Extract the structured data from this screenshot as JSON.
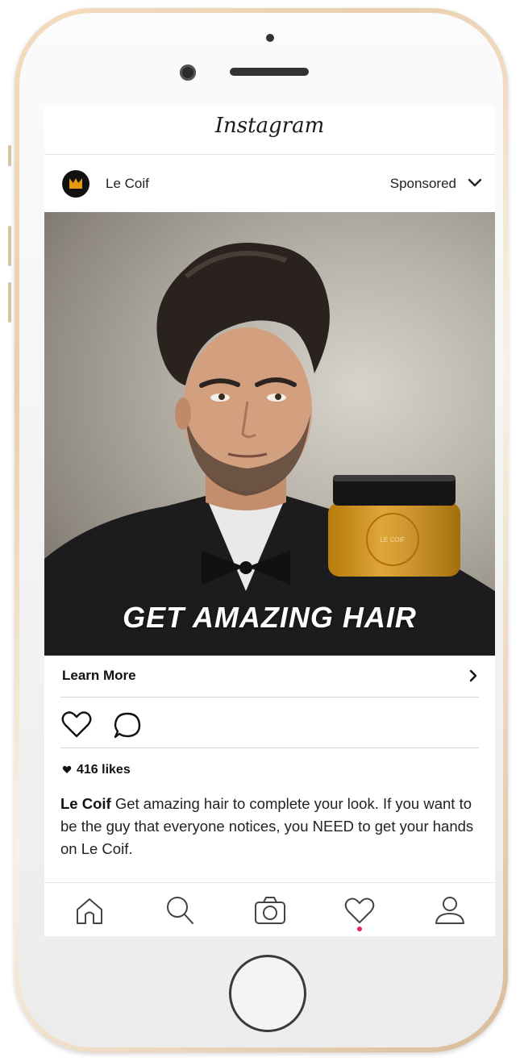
{
  "header": {
    "app_title": "Instagram"
  },
  "post": {
    "username": "Le Coif",
    "sponsored_label": "Sponsored",
    "ad_headline": "GET AMAZING HAIR",
    "cta_label": "Learn More",
    "likes_text": "416 likes",
    "caption_user": "Le Coif",
    "caption_text": " Get amazing hair to complete your look. If you want to be the guy that everyone notices, you NEED to get your hands on Le Coif.",
    "product_label": "LE COIF"
  },
  "tabbar": {
    "items": [
      {
        "icon": "home-icon"
      },
      {
        "icon": "search-icon"
      },
      {
        "icon": "camera-icon"
      },
      {
        "icon": "activity-heart-icon"
      },
      {
        "icon": "profile-icon"
      }
    ]
  },
  "colors": {
    "notification_dot": "#e0245e",
    "product_gold": "#d8920f"
  }
}
